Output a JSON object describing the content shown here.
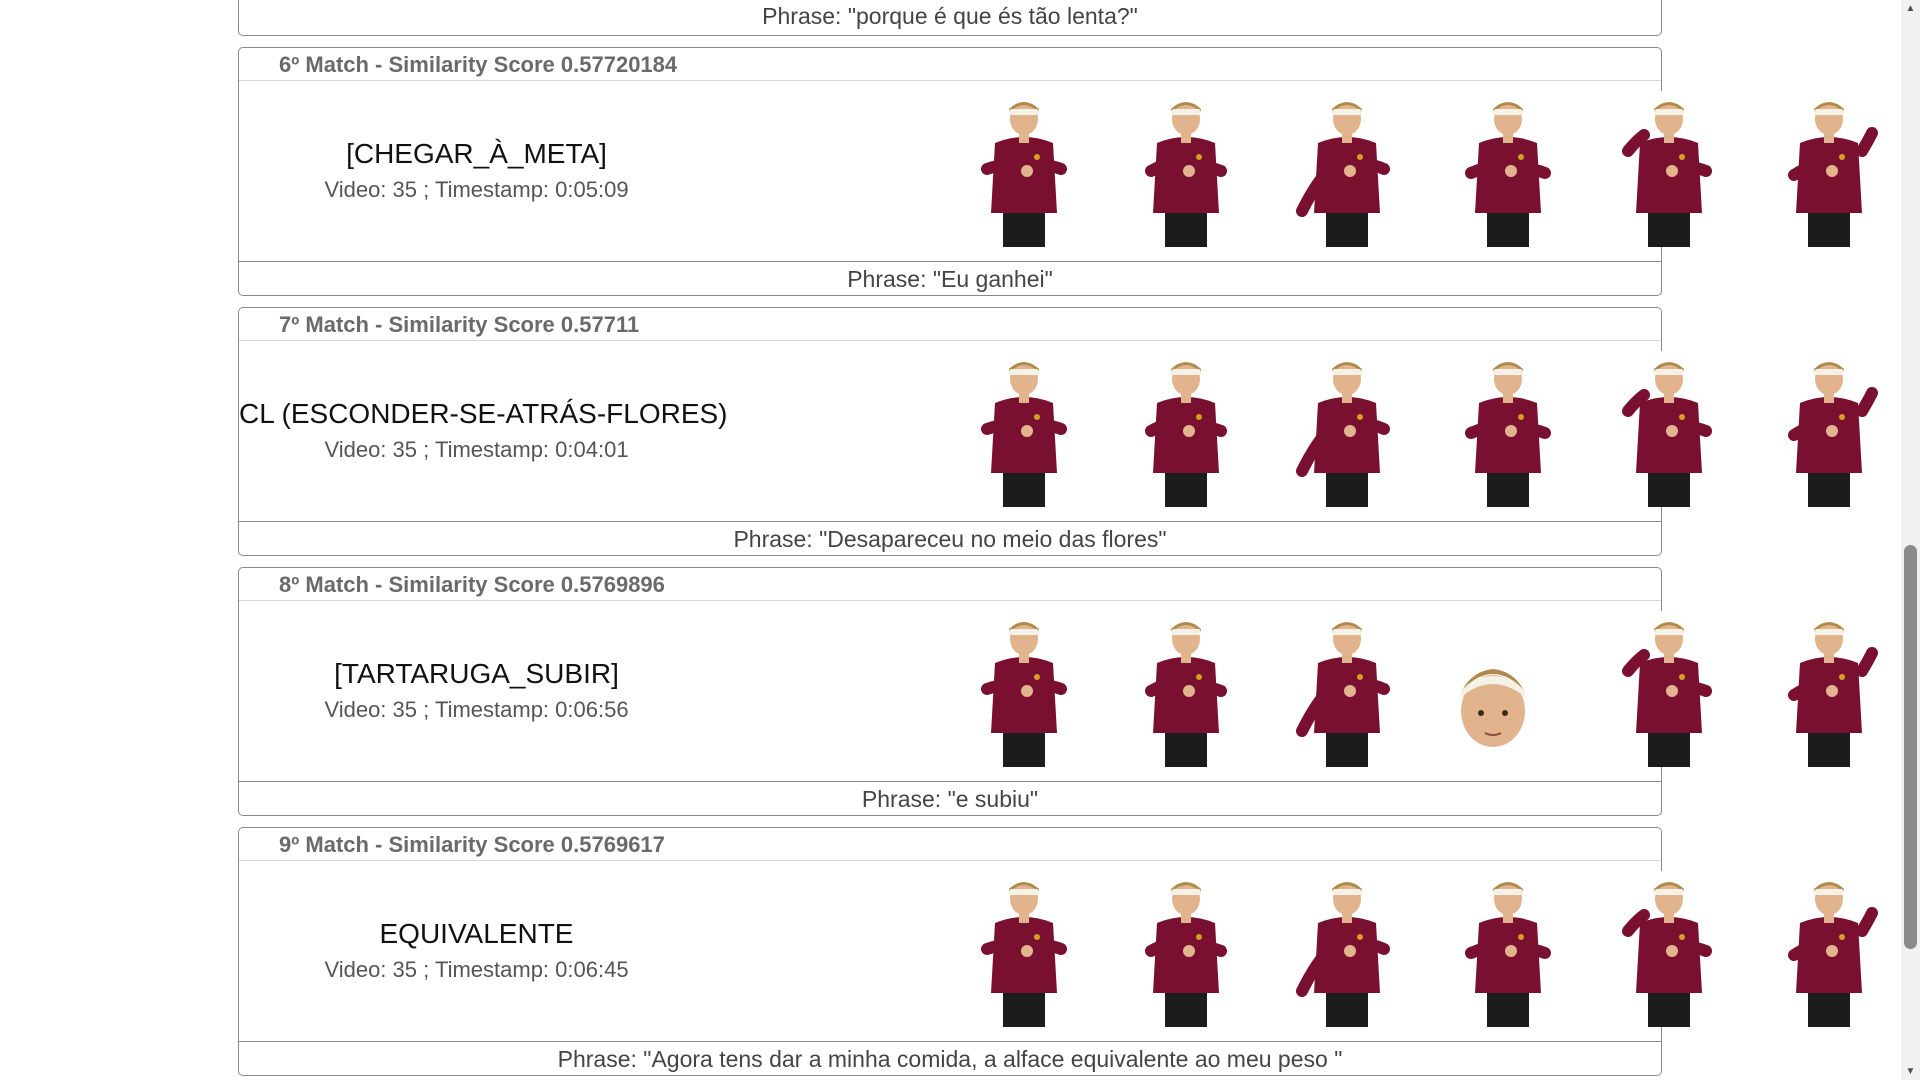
{
  "top_phrase": "Phrase: \"porque é que és tão lenta?\"",
  "matches": [
    {
      "header": "6º Match - Similarity Score 0.57720184",
      "gloss": "[CHEGAR_À_META]",
      "meta": "Video: 35 ; Timestamp: 0:05:09",
      "phrase": "Phrase: \"Eu ganhei\""
    },
    {
      "header": "7º Match - Similarity Score 0.57711",
      "gloss": "CL (ESCONDER-SE-ATRÁS-FLORES)",
      "meta": "Video: 35 ; Timestamp: 0:04:01",
      "phrase": "Phrase: \"Desapareceu no meio das flores\""
    },
    {
      "header": "8º Match - Similarity Score 0.5769896",
      "gloss": "[TARTARUGA_SUBIR]",
      "meta": "Video: 35 ; Timestamp: 0:06:56",
      "phrase": "Phrase: \"e subiu\""
    },
    {
      "header": "9º Match - Similarity Score 0.5769617",
      "gloss": "EQUIVALENTE",
      "meta": "Video: 35 ; Timestamp: 0:06:45",
      "phrase": "Phrase: \"Agora tens dar a minha comida, a alface equivalente ao meu peso \""
    }
  ],
  "colors": {
    "shirt": "#7a1030",
    "pants": "#1c1c1c",
    "skin": "#e2b48e",
    "hair": "#b08a4a",
    "headband": "#f4f1e6"
  }
}
